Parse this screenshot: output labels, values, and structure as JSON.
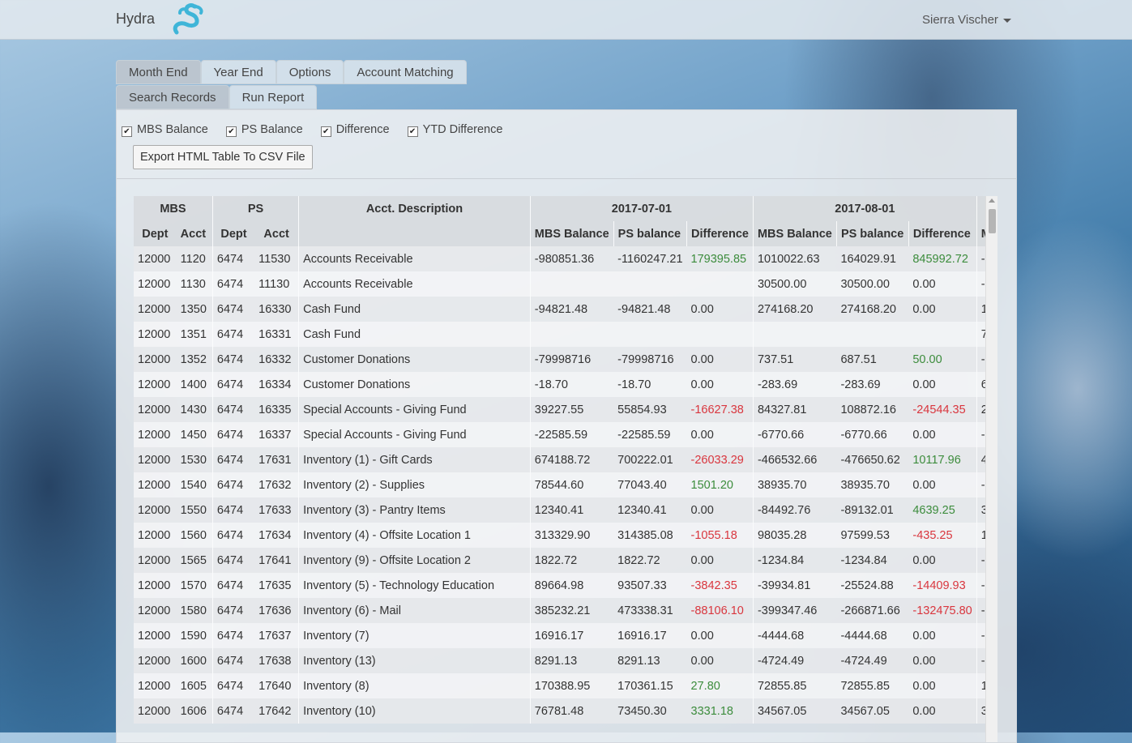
{
  "navbar": {
    "brand": "Hydra",
    "user": "Sierra Vischer"
  },
  "tabs": {
    "row1": [
      "Month End",
      "Year End",
      "Options",
      "Account Matching"
    ],
    "row2": [
      "Search Records",
      "Run Report"
    ]
  },
  "options": {
    "mbs_balance": "MBS Balance",
    "ps_balance": "PS Balance",
    "difference": "Difference",
    "ytd_difference": "YTD Difference",
    "export_button": "Export HTML Table To CSV File"
  },
  "table": {
    "group_headers": {
      "mbs": "MBS",
      "ps": "PS",
      "desc": "Acct. Description",
      "period1": "2017-07-01",
      "period2": "2017-08-01"
    },
    "sub_headers": [
      "Dept",
      "Acct",
      "Dept",
      "Acct",
      "",
      "MBS Balance",
      "PS balance",
      "Difference",
      "MBS Balance",
      "PS balance",
      "Difference",
      "M"
    ],
    "rows": [
      [
        "12000",
        "1120",
        "6474",
        "11530",
        "Accounts Receivable",
        "-980851.36",
        "-1160247.21",
        "179395.85",
        "1010022.63",
        "164029.91",
        "845992.72",
        "-"
      ],
      [
        "12000",
        "1130",
        "6474",
        "11130",
        "Accounts Receivable",
        "",
        "",
        "",
        "30500.00",
        "30500.00",
        "0.00",
        "-"
      ],
      [
        "12000",
        "1350",
        "6474",
        "16330",
        "Cash Fund",
        "-94821.48",
        "-94821.48",
        "0.00",
        "274168.20",
        "274168.20",
        "0.00",
        "1"
      ],
      [
        "12000",
        "1351",
        "6474",
        "16331",
        "Cash Fund",
        "",
        "",
        "",
        "",
        "",
        "",
        "7"
      ],
      [
        "12000",
        "1352",
        "6474",
        "16332",
        "Customer Donations",
        "-79998716",
        "-79998716",
        "0.00",
        "737.51",
        "687.51",
        "50.00",
        "-"
      ],
      [
        "12000",
        "1400",
        "6474",
        "16334",
        "Customer Donations",
        "-18.70",
        "-18.70",
        "0.00",
        "-283.69",
        "-283.69",
        "0.00",
        "6"
      ],
      [
        "12000",
        "1430",
        "6474",
        "16335",
        "Special Accounts - Giving Fund",
        "39227.55",
        "55854.93",
        "-16627.38",
        "84327.81",
        "108872.16",
        "-24544.35",
        "2"
      ],
      [
        "12000",
        "1450",
        "6474",
        "16337",
        "Special Accounts - Giving Fund",
        "-22585.59",
        "-22585.59",
        "0.00",
        "-6770.66",
        "-6770.66",
        "0.00",
        "-"
      ],
      [
        "12000",
        "1530",
        "6474",
        "17631",
        "Inventory (1) - Gift Cards",
        "674188.72",
        "700222.01",
        "-26033.29",
        "-466532.66",
        "-476650.62",
        "10117.96",
        "4"
      ],
      [
        "12000",
        "1540",
        "6474",
        "17632",
        "Inventory (2) - Supplies",
        "78544.60",
        "77043.40",
        "1501.20",
        "38935.70",
        "38935.70",
        "0.00",
        "-"
      ],
      [
        "12000",
        "1550",
        "6474",
        "17633",
        "Inventory (3) - Pantry Items",
        "12340.41",
        "12340.41",
        "0.00",
        "-84492.76",
        "-89132.01",
        "4639.25",
        "3"
      ],
      [
        "12000",
        "1560",
        "6474",
        "17634",
        "Inventory (4) - Offsite Location 1",
        "313329.90",
        "314385.08",
        "-1055.18",
        "98035.28",
        "97599.53",
        "-435.25",
        "1"
      ],
      [
        "12000",
        "1565",
        "6474",
        "17641",
        "Inventory (9) - Offsite Location 2",
        "1822.72",
        "1822.72",
        "0.00",
        "-1234.84",
        "-1234.84",
        "0.00",
        "-"
      ],
      [
        "12000",
        "1570",
        "6474",
        "17635",
        "Inventory (5) - Technology Education",
        "89664.98",
        "93507.33",
        "-3842.35",
        "-39934.81",
        "-25524.88",
        "-14409.93",
        "-"
      ],
      [
        "12000",
        "1580",
        "6474",
        "17636",
        "Inventory (6) - Mail",
        "385232.21",
        "473338.31",
        "-88106.10",
        "-399347.46",
        "-266871.66",
        "-132475.80",
        "-"
      ],
      [
        "12000",
        "1590",
        "6474",
        "17637",
        "Inventory (7)",
        "16916.17",
        "16916.17",
        "0.00",
        "-4444.68",
        "-4444.68",
        "0.00",
        "-"
      ],
      [
        "12000",
        "1600",
        "6474",
        "17638",
        "Inventory (13)",
        "8291.13",
        "8291.13",
        "0.00",
        "-4724.49",
        "-4724.49",
        "0.00",
        "-"
      ],
      [
        "12000",
        "1605",
        "6474",
        "17640",
        "Inventory (8)",
        "170388.95",
        "170361.15",
        "27.80",
        "72855.85",
        "72855.85",
        "0.00",
        "1"
      ],
      [
        "12000",
        "1606",
        "6474",
        "17642",
        "Inventory (10)",
        "76781.48",
        "73450.30",
        "3331.18",
        "34567.05",
        "34567.05",
        "0.00",
        "3"
      ]
    ]
  },
  "colors": {
    "positive": "#3c8c3c",
    "negative": "#d9363e"
  }
}
